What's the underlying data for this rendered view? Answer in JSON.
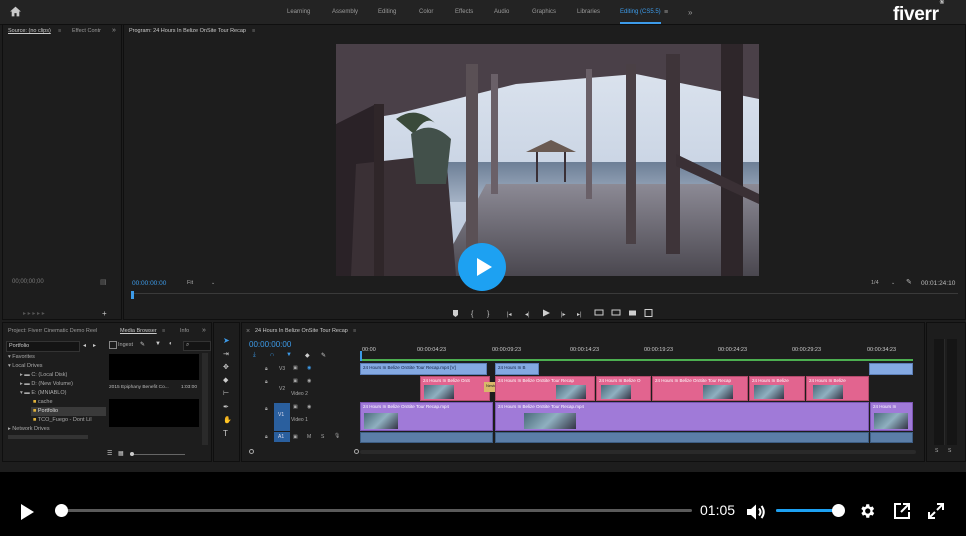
{
  "app": {
    "workspaces": [
      {
        "label": "Learning",
        "active": false
      },
      {
        "label": "Assembly",
        "active": false
      },
      {
        "label": "Editing",
        "active": false
      },
      {
        "label": "Color",
        "active": false
      },
      {
        "label": "Effects",
        "active": false
      },
      {
        "label": "Audio",
        "active": false
      },
      {
        "label": "Graphics",
        "active": false
      },
      {
        "label": "Libraries",
        "active": false
      },
      {
        "label": "Editing (CS5.5)",
        "active": true
      }
    ],
    "more_glyph": "»",
    "brand": {
      "logo_text": "fiverr",
      "registered": "®"
    }
  },
  "source_panel": {
    "tab_label": "Source: (no clips)",
    "effect_tab": "Effect Contr",
    "timecode": "00;00;00;00"
  },
  "program_panel": {
    "title": "Program: 24 Hours In Belize OnSite Tour Recap",
    "timecode_in": "00:00:00:00",
    "fit_label": "Fit",
    "ratio": "1/4",
    "timecode_out": "00:01:24:10"
  },
  "project_panel": {
    "tabs": [
      "Project: Fiverr Cinematic Demo Reel",
      "Media Browser",
      "Info"
    ],
    "location": "Portfolio",
    "ingest_label": "Ingest",
    "tree": [
      {
        "label": "Favorites",
        "level": 0
      },
      {
        "label": "Local Drives",
        "level": 0
      },
      {
        "label": "C: (Local Disk)",
        "level": 1
      },
      {
        "label": "D: (New Volume)",
        "level": 1
      },
      {
        "label": "E: (MNIABLO)",
        "level": 1
      },
      {
        "label": "cache",
        "level": 2
      },
      {
        "label": "Portfolio",
        "level": 2
      },
      {
        "label": "TCO_Fuego - Dont Lil",
        "level": 2
      },
      {
        "label": "Network Drives",
        "level": 0
      }
    ],
    "media_item": {
      "name": "2015 Epiphany Benefit Co...",
      "duration": "1:03:00"
    }
  },
  "timeline": {
    "title": "24 Hours In Belize OnSite Tour Recap",
    "timecode": "00:00:00:00",
    "ruler": [
      "00:00",
      "00:00:04:23",
      "00:00:09:23",
      "00:00:14:23",
      "00:00:19:23",
      "00:00:24:23",
      "00:00:29:23",
      "00:00:34:23"
    ],
    "tracks": [
      {
        "id": "V3",
        "name": ""
      },
      {
        "id": "V2",
        "name": "Video 2"
      },
      {
        "id": "V1",
        "name": "Video 1"
      },
      {
        "id": "A1",
        "name": ""
      }
    ],
    "clips_v3": [
      "24 Hours In Belize OnSite Tour Recap.mp4 [V]",
      "24 Hours In B"
    ],
    "clips_v2": [
      "24 Hours In Belize OnS",
      "24 Hours In Belize OnSite Tour Recap",
      "24 Hours In Belize O",
      "24 Hours In Belize OnSite Tour Recap",
      "24 Hours In Belize",
      "24 Hours In Belize"
    ],
    "clips_v1": [
      "24 Hours In Belize OnSite Tour Recap.mp4",
      "24 Hours In Belize OnSite Tour Recap.mp4",
      "24 Hours In"
    ],
    "nested_label": "Nested"
  },
  "audio_meter": {
    "labels": [
      "S",
      "S"
    ]
  },
  "player": {
    "time": "01:05",
    "progress": 0.01,
    "volume": 1.0
  },
  "colors": {
    "accent": "#1da1f2",
    "premiere_blue": "#3d9be9",
    "pink": "#e2648f",
    "purple": "#a07ad8"
  }
}
